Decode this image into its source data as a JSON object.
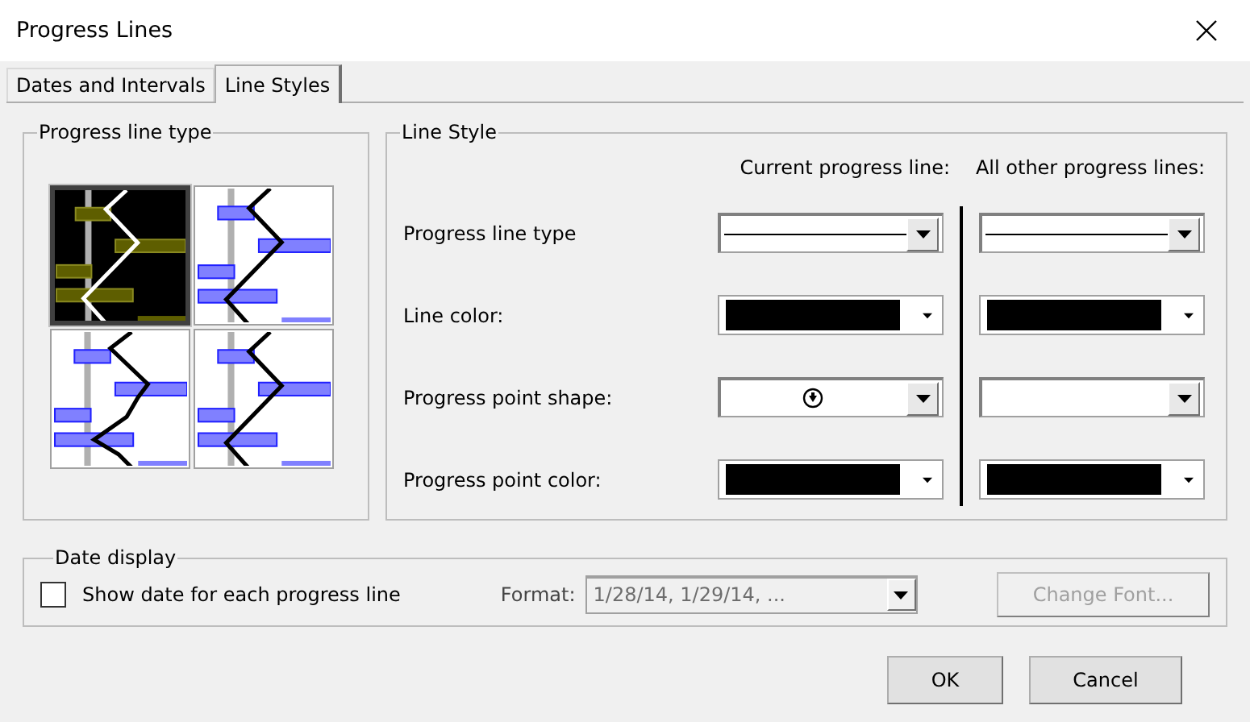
{
  "window": {
    "title": "Progress Lines"
  },
  "tabs": [
    {
      "label": "Dates and Intervals",
      "selected": false
    },
    {
      "label": "Line Styles",
      "selected": true
    }
  ],
  "line_type_group": {
    "title": "Progress line type",
    "options": [
      {
        "kind": "zigzag",
        "selected": true
      },
      {
        "kind": "zigzag",
        "selected": false
      },
      {
        "kind": "stepped",
        "selected": false
      },
      {
        "kind": "zigzag",
        "selected": false
      }
    ]
  },
  "line_style_group": {
    "title": "Line Style",
    "columns": [
      "Current progress line:",
      "All other progress lines:"
    ],
    "rows": [
      {
        "label": "Progress line type",
        "cells": [
          {
            "kind": "line"
          },
          {
            "kind": "line"
          }
        ]
      },
      {
        "label": "Line color:",
        "cells": [
          {
            "kind": "color",
            "color": "#000000"
          },
          {
            "kind": "color",
            "color": "#000000"
          }
        ]
      },
      {
        "label": "Progress point shape:",
        "cells": [
          {
            "kind": "shape",
            "has_point": true
          },
          {
            "kind": "shape",
            "has_point": false
          }
        ]
      },
      {
        "label": "Progress point color:",
        "cells": [
          {
            "kind": "color",
            "color": "#000000"
          },
          {
            "kind": "color",
            "color": "#000000"
          }
        ]
      }
    ]
  },
  "date_display": {
    "title": "Date display",
    "checkbox": {
      "label": "Show date for each progress line",
      "checked": false
    },
    "format": {
      "label": "Format:",
      "value": "1/28/14, 1/29/14, ...",
      "disabled": true
    },
    "change_font": {
      "label": "Change Font...",
      "disabled": true
    }
  },
  "buttons": [
    {
      "label": "OK"
    },
    {
      "label": "Cancel"
    }
  ]
}
